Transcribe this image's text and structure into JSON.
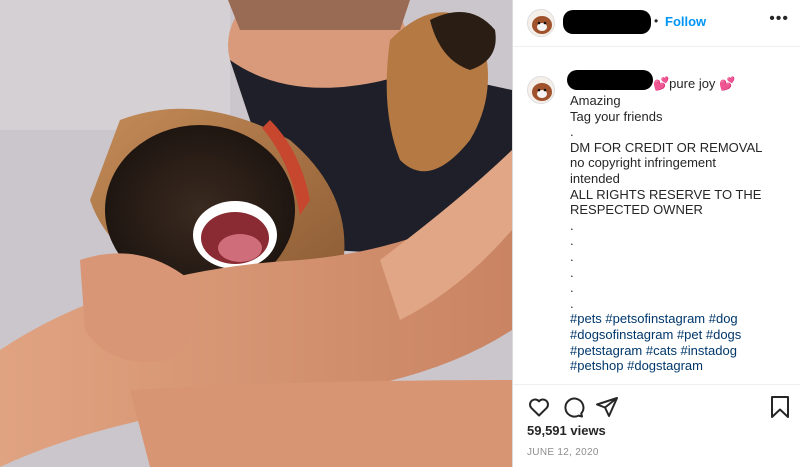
{
  "media": {
    "description_alt": "",
    "overlay": "dog-video-frame"
  },
  "header": {
    "follow_label": "Follow",
    "separator": "•",
    "more_icon": "more-icon"
  },
  "caption": {
    "title_suffix": "💕pure joy 💕",
    "lines": [
      "Amazing",
      "Tag your friends",
      ".",
      "DM FOR CREDIT OR REMOVAL",
      "no copyright infringement",
      "intended",
      "ALL RIGHTS RESERVE TO THE",
      "RESPECTED OWNER",
      ".",
      ".",
      ".",
      ".",
      ".",
      "."
    ],
    "hashtags": [
      "#pets #petsofinstagram #dog",
      "#dogsofinstagram #pet #dogs",
      "#petstagram #cats #instadog",
      "#petshop #dogstagram"
    ]
  },
  "actions": {
    "like_icon": "heart-icon",
    "comment_icon": "comment-icon",
    "share_icon": "share-icon",
    "save_icon": "bookmark-icon",
    "views": "59,591 views",
    "date": "JUNE 12, 2020"
  },
  "colors": {
    "accent": "#0095f6",
    "hashtag": "#00376b",
    "text": "#262626",
    "muted": "#8e8e8e"
  }
}
